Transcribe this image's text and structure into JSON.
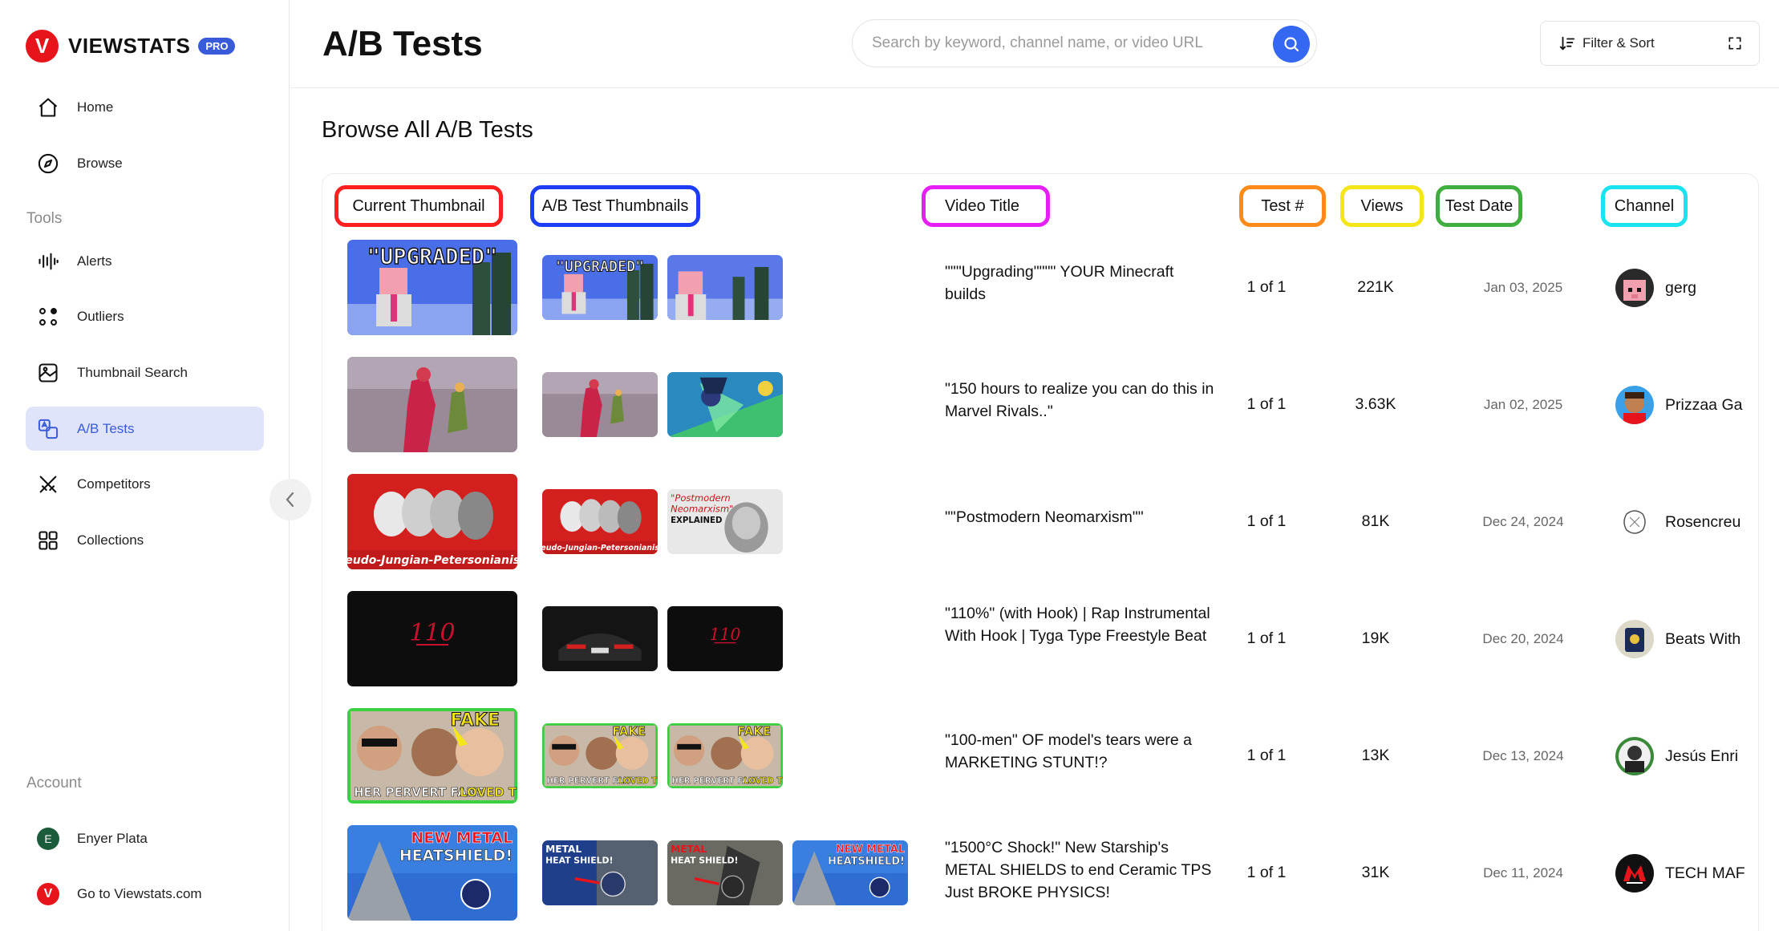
{
  "brand": {
    "name": "VIEWSTATS",
    "badge": "PRO",
    "mark": "V"
  },
  "sidebar": {
    "nav": [
      {
        "label": "Home",
        "icon": "home-icon"
      },
      {
        "label": "Browse",
        "icon": "compass-icon"
      }
    ],
    "tools_label": "Tools",
    "tools": [
      {
        "label": "Alerts",
        "icon": "audio-bars-icon"
      },
      {
        "label": "Outliers",
        "icon": "outliers-icon"
      },
      {
        "label": "Thumbnail Search",
        "icon": "image-search-icon"
      },
      {
        "label": "A/B Tests",
        "icon": "ab-test-icon",
        "active": true
      },
      {
        "label": "Competitors",
        "icon": "swords-icon"
      },
      {
        "label": "Collections",
        "icon": "collections-icon"
      }
    ],
    "account_label": "Account",
    "account": [
      {
        "label": "Enyer Plata",
        "avatar": "E"
      },
      {
        "label": "Go to Viewstats.com",
        "avatar": "V"
      }
    ]
  },
  "header": {
    "title": "A/B Tests",
    "search_placeholder": "Search by keyword, channel name, or video URL",
    "filter_label": "Filter & Sort"
  },
  "content": {
    "title": "Browse All A/B Tests",
    "columns": [
      {
        "label": "Current Thumbnail",
        "color": "#ff1f1f"
      },
      {
        "label": "A/B Test Thumbnails",
        "color": "#1d3df5"
      },
      {
        "label": "Video Title",
        "color": "#e51ff5"
      },
      {
        "label": "Test #",
        "color": "#ff8a1a"
      },
      {
        "label": "Views",
        "color": "#f5e61a"
      },
      {
        "label": "Test Date",
        "color": "#3fae3f"
      },
      {
        "label": "Channel",
        "color": "#1ae3f0"
      }
    ],
    "rows": [
      {
        "title": "\"\"\"Upgrading\"\"\"\" YOUR Minecraft builds",
        "test": "1 of 1",
        "views": "221K",
        "date": "Jan 03, 2025",
        "channel": "gerg"
      },
      {
        "title": "\"150 hours to realize you can do this in Marvel Rivals..\"",
        "test": "1 of 1",
        "views": "3.63K",
        "date": "Jan 02, 2025",
        "channel": "Prizzaa Ga"
      },
      {
        "title": "\"\"Postmodern Neomarxism\"\"",
        "test": "1 of 1",
        "views": "81K",
        "date": "Dec 24, 2024",
        "channel": "Rosencreu"
      },
      {
        "title": "\"110%\" (with Hook) | Rap Instrumental With Hook | Tyga Type Freestyle Beat",
        "test": "1 of 1",
        "views": "19K",
        "date": "Dec 20, 2024",
        "channel": "Beats With"
      },
      {
        "title": "\"100-men\" OF model's tears were a MARKETING STUNT!?",
        "test": "1 of 1",
        "views": "13K",
        "date": "Dec 13, 2024",
        "channel": "Jesús Enri"
      },
      {
        "title": "\"1500°C Shock!\" New Starship's METAL SHIELDS to end Ceramic TPS Just BROKE PHYSICS!",
        "test": "1 of 1",
        "views": "31K",
        "date": "Dec 11, 2024",
        "channel": "TECH MAF"
      }
    ],
    "thumb_text": {
      "upgraded": "\"UPGRADED\"",
      "postmodern": "\"Postmodern",
      "neomarxism": "Neomarxism\"",
      "explained": "EXPLAINED",
      "freudo": "Freudo-Jungian-Petersonianism",
      "n110": "110",
      "fake": "FAKE",
      "pervert_a": "HER PERVERT FANS",
      "pervert_b": "LOVED THIS",
      "new_metal": "NEW METAL",
      "heatshield": "HEATSHIELD!",
      "metal": "METAL",
      "heat_shield": "HEAT SHIELD!"
    }
  }
}
